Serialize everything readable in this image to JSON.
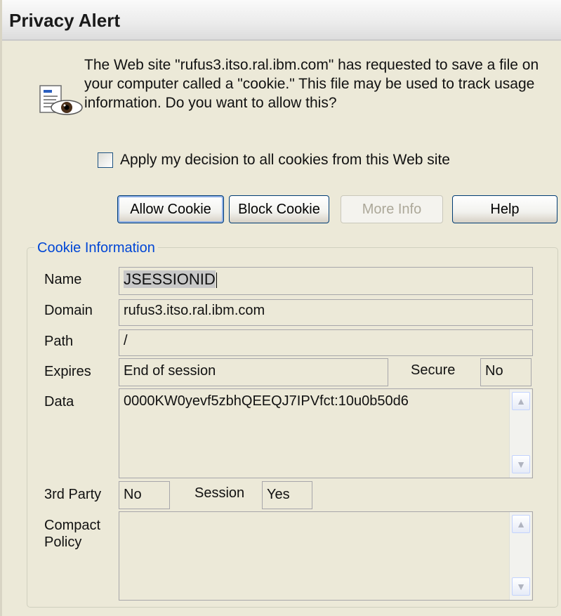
{
  "window": {
    "title": "Privacy Alert"
  },
  "message": "The Web site \"rufus3.itso.ral.ibm.com\" has requested to save a file on your computer called a \"cookie.\"  This file may be used to track usage information. Do you want to allow this?",
  "checkbox": {
    "label": "Apply my decision to all cookies from this Web site",
    "checked": false
  },
  "buttons": {
    "allow": "Allow Cookie",
    "block": "Block Cookie",
    "more_info": "More Info",
    "help": "Help"
  },
  "cookie_info": {
    "legend": "Cookie Information",
    "labels": {
      "name": "Name",
      "domain": "Domain",
      "path": "Path",
      "expires": "Expires",
      "secure": "Secure",
      "data": "Data",
      "third_party": "3rd Party",
      "session": "Session",
      "compact_policy_line1": "Compact",
      "compact_policy_line2": "Policy"
    },
    "values": {
      "name": "JSESSIONID",
      "domain": "rufus3.itso.ral.ibm.com",
      "path": "/",
      "expires": "End of session",
      "secure": "No",
      "data": "0000KW0yevf5zbhQEEQJ7IPVfct:10u0b50d6",
      "third_party": "No",
      "session": "Yes",
      "compact_policy": ""
    }
  },
  "icons": {
    "cookie": "cookie-document-eye-icon",
    "scroll_up": "▲",
    "scroll_down": "▼"
  },
  "colors": {
    "dialog_bg": "#ece9d8",
    "legend_text": "#0046d5",
    "button_border": "#003c74"
  }
}
